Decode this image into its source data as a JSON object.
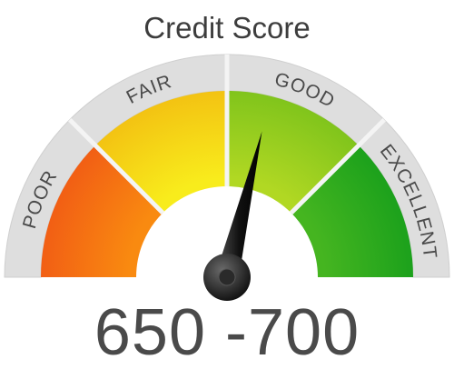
{
  "title": "Credit Score",
  "bands": [
    {
      "label": "POOR",
      "color_outer": "#f15a14",
      "color_inner": "#f98a10"
    },
    {
      "label": "FAIR",
      "color_outer": "#f3c20f",
      "color_inner": "#f7e21a"
    },
    {
      "label": "GOOD",
      "color_outer": "#7cc21b",
      "color_inner": "#a9d51f"
    },
    {
      "label": "EXCELLENT",
      "color_outer": "#129e1c",
      "color_inner": "#3db11f"
    }
  ],
  "score_range": "650 -700",
  "needle_fraction": 0.575,
  "colors": {
    "outer_ring": "#dedede",
    "divider": "#f2f2f2",
    "needle": "#1a1a1a",
    "text": "#4a4a4a"
  }
}
